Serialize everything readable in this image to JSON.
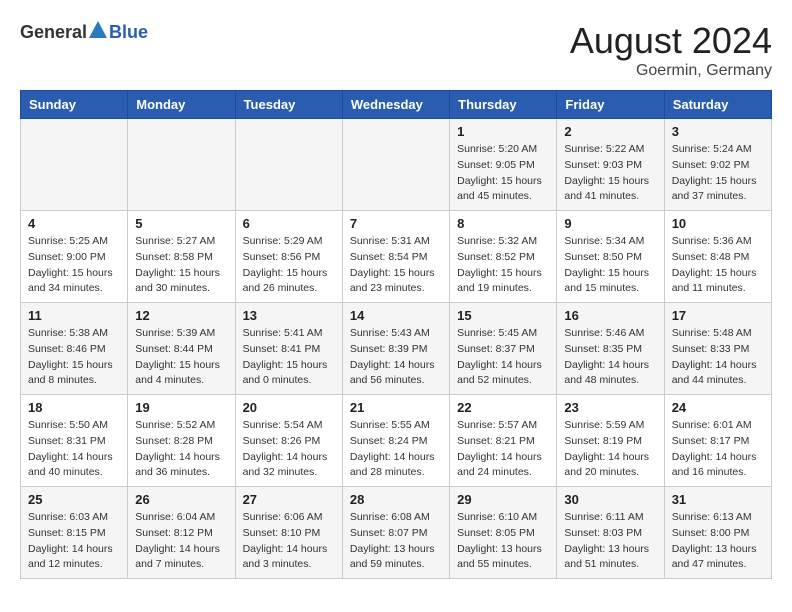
{
  "header": {
    "logo_general": "General",
    "logo_blue": "Blue",
    "month_year": "August 2024",
    "location": "Goermin, Germany"
  },
  "days_of_week": [
    "Sunday",
    "Monday",
    "Tuesday",
    "Wednesday",
    "Thursday",
    "Friday",
    "Saturday"
  ],
  "weeks": [
    [
      {
        "day": "",
        "content": ""
      },
      {
        "day": "",
        "content": ""
      },
      {
        "day": "",
        "content": ""
      },
      {
        "day": "",
        "content": ""
      },
      {
        "day": "1",
        "content": "Sunrise: 5:20 AM\nSunset: 9:05 PM\nDaylight: 15 hours\nand 45 minutes."
      },
      {
        "day": "2",
        "content": "Sunrise: 5:22 AM\nSunset: 9:03 PM\nDaylight: 15 hours\nand 41 minutes."
      },
      {
        "day": "3",
        "content": "Sunrise: 5:24 AM\nSunset: 9:02 PM\nDaylight: 15 hours\nand 37 minutes."
      }
    ],
    [
      {
        "day": "4",
        "content": "Sunrise: 5:25 AM\nSunset: 9:00 PM\nDaylight: 15 hours\nand 34 minutes."
      },
      {
        "day": "5",
        "content": "Sunrise: 5:27 AM\nSunset: 8:58 PM\nDaylight: 15 hours\nand 30 minutes."
      },
      {
        "day": "6",
        "content": "Sunrise: 5:29 AM\nSunset: 8:56 PM\nDaylight: 15 hours\nand 26 minutes."
      },
      {
        "day": "7",
        "content": "Sunrise: 5:31 AM\nSunset: 8:54 PM\nDaylight: 15 hours\nand 23 minutes."
      },
      {
        "day": "8",
        "content": "Sunrise: 5:32 AM\nSunset: 8:52 PM\nDaylight: 15 hours\nand 19 minutes."
      },
      {
        "day": "9",
        "content": "Sunrise: 5:34 AM\nSunset: 8:50 PM\nDaylight: 15 hours\nand 15 minutes."
      },
      {
        "day": "10",
        "content": "Sunrise: 5:36 AM\nSunset: 8:48 PM\nDaylight: 15 hours\nand 11 minutes."
      }
    ],
    [
      {
        "day": "11",
        "content": "Sunrise: 5:38 AM\nSunset: 8:46 PM\nDaylight: 15 hours\nand 8 minutes."
      },
      {
        "day": "12",
        "content": "Sunrise: 5:39 AM\nSunset: 8:44 PM\nDaylight: 15 hours\nand 4 minutes."
      },
      {
        "day": "13",
        "content": "Sunrise: 5:41 AM\nSunset: 8:41 PM\nDaylight: 15 hours\nand 0 minutes."
      },
      {
        "day": "14",
        "content": "Sunrise: 5:43 AM\nSunset: 8:39 PM\nDaylight: 14 hours\nand 56 minutes."
      },
      {
        "day": "15",
        "content": "Sunrise: 5:45 AM\nSunset: 8:37 PM\nDaylight: 14 hours\nand 52 minutes."
      },
      {
        "day": "16",
        "content": "Sunrise: 5:46 AM\nSunset: 8:35 PM\nDaylight: 14 hours\nand 48 minutes."
      },
      {
        "day": "17",
        "content": "Sunrise: 5:48 AM\nSunset: 8:33 PM\nDaylight: 14 hours\nand 44 minutes."
      }
    ],
    [
      {
        "day": "18",
        "content": "Sunrise: 5:50 AM\nSunset: 8:31 PM\nDaylight: 14 hours\nand 40 minutes."
      },
      {
        "day": "19",
        "content": "Sunrise: 5:52 AM\nSunset: 8:28 PM\nDaylight: 14 hours\nand 36 minutes."
      },
      {
        "day": "20",
        "content": "Sunrise: 5:54 AM\nSunset: 8:26 PM\nDaylight: 14 hours\nand 32 minutes."
      },
      {
        "day": "21",
        "content": "Sunrise: 5:55 AM\nSunset: 8:24 PM\nDaylight: 14 hours\nand 28 minutes."
      },
      {
        "day": "22",
        "content": "Sunrise: 5:57 AM\nSunset: 8:21 PM\nDaylight: 14 hours\nand 24 minutes."
      },
      {
        "day": "23",
        "content": "Sunrise: 5:59 AM\nSunset: 8:19 PM\nDaylight: 14 hours\nand 20 minutes."
      },
      {
        "day": "24",
        "content": "Sunrise: 6:01 AM\nSunset: 8:17 PM\nDaylight: 14 hours\nand 16 minutes."
      }
    ],
    [
      {
        "day": "25",
        "content": "Sunrise: 6:03 AM\nSunset: 8:15 PM\nDaylight: 14 hours\nand 12 minutes."
      },
      {
        "day": "26",
        "content": "Sunrise: 6:04 AM\nSunset: 8:12 PM\nDaylight: 14 hours\nand 7 minutes."
      },
      {
        "day": "27",
        "content": "Sunrise: 6:06 AM\nSunset: 8:10 PM\nDaylight: 14 hours\nand 3 minutes."
      },
      {
        "day": "28",
        "content": "Sunrise: 6:08 AM\nSunset: 8:07 PM\nDaylight: 13 hours\nand 59 minutes."
      },
      {
        "day": "29",
        "content": "Sunrise: 6:10 AM\nSunset: 8:05 PM\nDaylight: 13 hours\nand 55 minutes."
      },
      {
        "day": "30",
        "content": "Sunrise: 6:11 AM\nSunset: 8:03 PM\nDaylight: 13 hours\nand 51 minutes."
      },
      {
        "day": "31",
        "content": "Sunrise: 6:13 AM\nSunset: 8:00 PM\nDaylight: 13 hours\nand 47 minutes."
      }
    ]
  ]
}
